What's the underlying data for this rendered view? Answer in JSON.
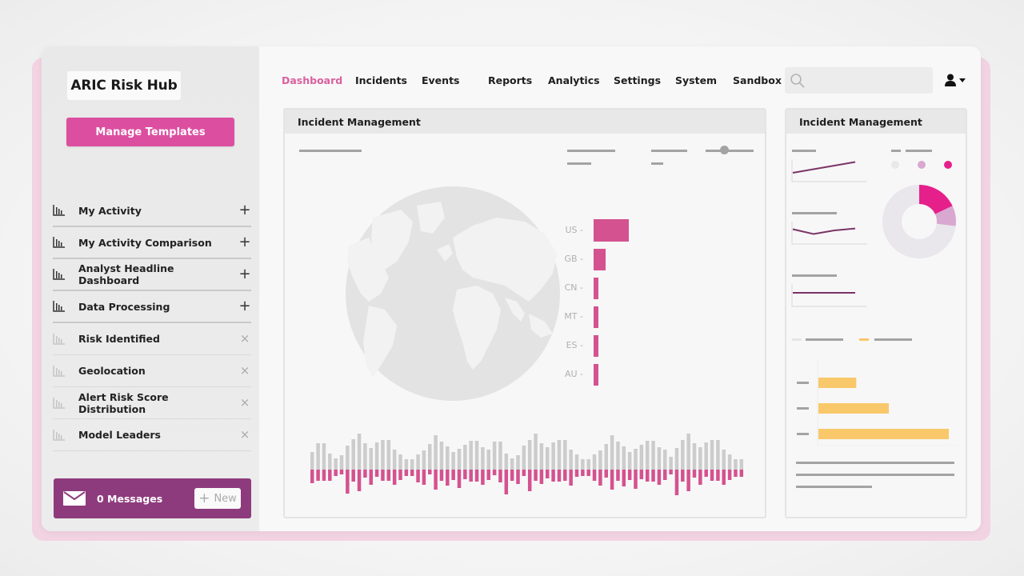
{
  "app": {
    "title": "ARIC Risk Hub"
  },
  "sidebar": {
    "manage_templates_label": "Manage Templates",
    "items": [
      {
        "label": "My Activity",
        "icon": "bar-chart-icon",
        "action": "+",
        "action_icon": "plus-icon",
        "state": "available"
      },
      {
        "label": "My Activity Comparison",
        "icon": "bar-chart-icon",
        "action": "+",
        "action_icon": "plus-icon",
        "state": "available"
      },
      {
        "label": "Analyst Headline Dashboard",
        "icon": "bar-chart-icon",
        "action": "+",
        "action_icon": "plus-icon",
        "state": "available"
      },
      {
        "label": "Data Processing",
        "icon": "bar-chart-icon",
        "action": "+",
        "action_icon": "plus-icon",
        "state": "available"
      },
      {
        "label": "Risk Identified",
        "icon": "bar-chart-icon",
        "action": "×",
        "action_icon": "close-icon",
        "state": "added"
      },
      {
        "label": "Geolocation",
        "icon": "bar-chart-icon",
        "action": "×",
        "action_icon": "close-icon",
        "state": "added"
      },
      {
        "label": "Alert Risk Score Distribution",
        "icon": "bar-chart-icon",
        "action": "×",
        "action_icon": "close-icon",
        "state": "added"
      },
      {
        "label": "Model Leaders",
        "icon": "bar-chart-icon",
        "action": "×",
        "action_icon": "close-icon",
        "state": "added"
      }
    ],
    "messages": {
      "label": "0 Messages",
      "count": 0,
      "new_label": "New",
      "new_icon": "+"
    }
  },
  "nav": {
    "items": [
      {
        "label": "Dashboard",
        "active": true
      },
      {
        "label": "Incidents",
        "active": false
      },
      {
        "label": "Events",
        "active": false
      },
      {
        "label": "Reports",
        "active": false
      },
      {
        "label": "Analytics",
        "active": false
      },
      {
        "label": "Settings",
        "active": false
      },
      {
        "label": "System",
        "active": false
      },
      {
        "label": "Sandbox",
        "active": false
      }
    ],
    "search": {
      "placeholder": "",
      "value": ""
    },
    "user_icon": "user-icon"
  },
  "colors": {
    "accent": "#dc4fa0",
    "active_nav": "#d9609f",
    "messages_bg": "#8e3b7e",
    "bar_pink": "#d4528f",
    "bar_gray": "#cccccc",
    "donut_magenta": "#e5208b",
    "donut_light": "#d9a8d0",
    "donut_bg": "#e9e6ec",
    "orange_bar": "#f9c86a",
    "line_purple": "#7a3466"
  },
  "panels": {
    "main": {
      "title": "Incident Management",
      "slider_value": 0.37,
      "country_chart": {
        "type": "bar",
        "categories": [
          "US",
          "GB",
          "CN",
          "MT",
          "ES",
          "AU"
        ],
        "values": [
          100,
          33,
          14,
          14,
          14,
          14
        ]
      },
      "waveform": {
        "up": [
          22,
          33,
          33,
          20,
          14,
          18,
          30,
          38,
          45,
          33,
          27,
          34,
          37,
          37,
          25,
          19,
          13,
          13,
          19,
          24,
          32,
          43,
          35,
          29,
          22,
          26,
          31,
          36,
          36,
          28,
          25,
          35,
          35,
          20,
          14,
          18,
          30,
          37,
          45,
          33,
          28,
          34,
          37,
          37,
          25,
          19,
          13,
          13,
          19,
          24,
          32,
          43,
          35,
          29,
          22,
          26,
          31,
          36,
          36,
          28,
          25,
          16,
          27,
          37,
          45,
          33,
          28,
          34,
          37,
          37,
          25,
          19,
          13,
          13
        ],
        "down": [
          17,
          14,
          14,
          14,
          8,
          6,
          30,
          15,
          27,
          10,
          19,
          9,
          14,
          14,
          19,
          13,
          8,
          8,
          16,
          19,
          6,
          25,
          14,
          20,
          13,
          23,
          12,
          15,
          15,
          19,
          13,
          7,
          16,
          31,
          14,
          18,
          8,
          27,
          14,
          18,
          11,
          15,
          15,
          14,
          20,
          9,
          8,
          8,
          14,
          20,
          10,
          25,
          14,
          21,
          13,
          24,
          12,
          15,
          15,
          19,
          13,
          6,
          32,
          15,
          27,
          10,
          19,
          9,
          14,
          14,
          19,
          13,
          9,
          9
        ]
      }
    },
    "side": {
      "title": "Incident Management",
      "sparklines": [
        {
          "points": [
            0.3,
            0.45,
            0.6,
            0.75
          ]
        },
        {
          "points": [
            0.55,
            0.35,
            0.5,
            0.58
          ]
        },
        {
          "points": [
            0.5,
            0.5,
            0.5,
            0.5
          ]
        }
      ],
      "donut": {
        "type": "pie",
        "slices": [
          {
            "name": "magenta",
            "value": 18
          },
          {
            "name": "light-purple",
            "value": 9
          },
          {
            "name": "gray",
            "value": 73
          }
        ]
      },
      "hbar": {
        "type": "bar",
        "values": [
          29,
          54,
          100
        ]
      }
    }
  }
}
